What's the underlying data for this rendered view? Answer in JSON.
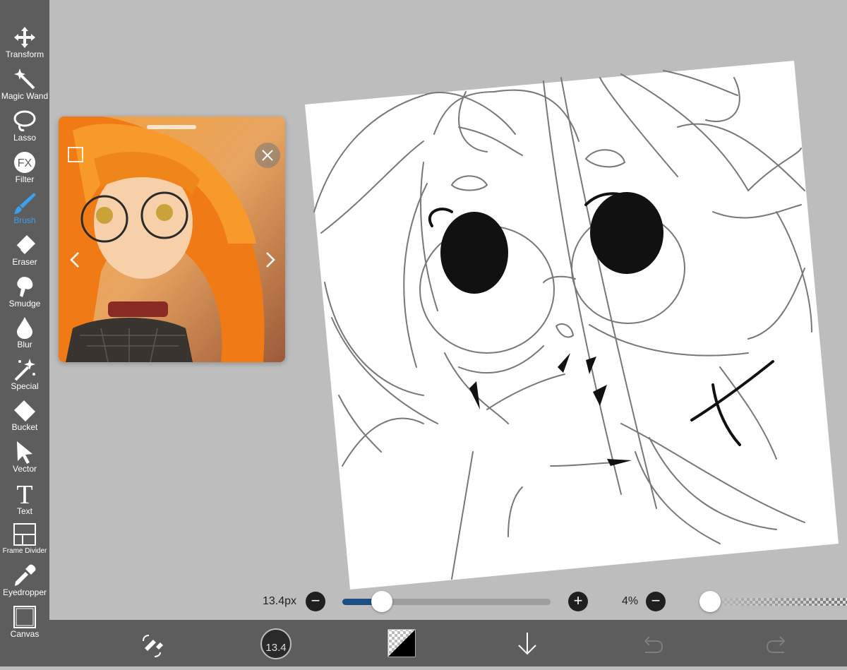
{
  "toolbar": {
    "tools": [
      {
        "label": "Transform",
        "icon": "transform-icon"
      },
      {
        "label": "Magic Wand",
        "icon": "magic-wand-icon"
      },
      {
        "label": "Lasso",
        "icon": "lasso-icon"
      },
      {
        "label": "Filter",
        "icon": "filter-fx-icon",
        "glyph": "FX"
      },
      {
        "label": "Brush",
        "icon": "brush-icon",
        "active": true
      },
      {
        "label": "Eraser",
        "icon": "eraser-icon"
      },
      {
        "label": "Smudge",
        "icon": "smudge-icon"
      },
      {
        "label": "Blur",
        "icon": "blur-icon"
      },
      {
        "label": "Special",
        "icon": "special-icon"
      },
      {
        "label": "Bucket",
        "icon": "bucket-icon"
      },
      {
        "label": "Vector",
        "icon": "vector-icon"
      },
      {
        "label": "Text",
        "icon": "text-icon",
        "glyph": "T"
      },
      {
        "label": "Frame Divider",
        "icon": "frame-divider-icon"
      },
      {
        "label": "Eyedropper",
        "icon": "eyedropper-icon"
      },
      {
        "label": "Canvas",
        "icon": "canvas-icon"
      }
    ],
    "active_color": "#3aa0ef"
  },
  "controls": {
    "size_value": "13.4px",
    "size_fraction": 0.19,
    "opacity_value": "4%",
    "opacity_fraction": 0.04,
    "minus": "−",
    "plus": "+"
  },
  "bottom_bar": {
    "brush_size_badge": "13.4"
  },
  "colors": {
    "toolbar_bg": "#5d5d5d",
    "workspace_bg": "#bdbdbd",
    "slider_fill": "#1d4f87"
  }
}
